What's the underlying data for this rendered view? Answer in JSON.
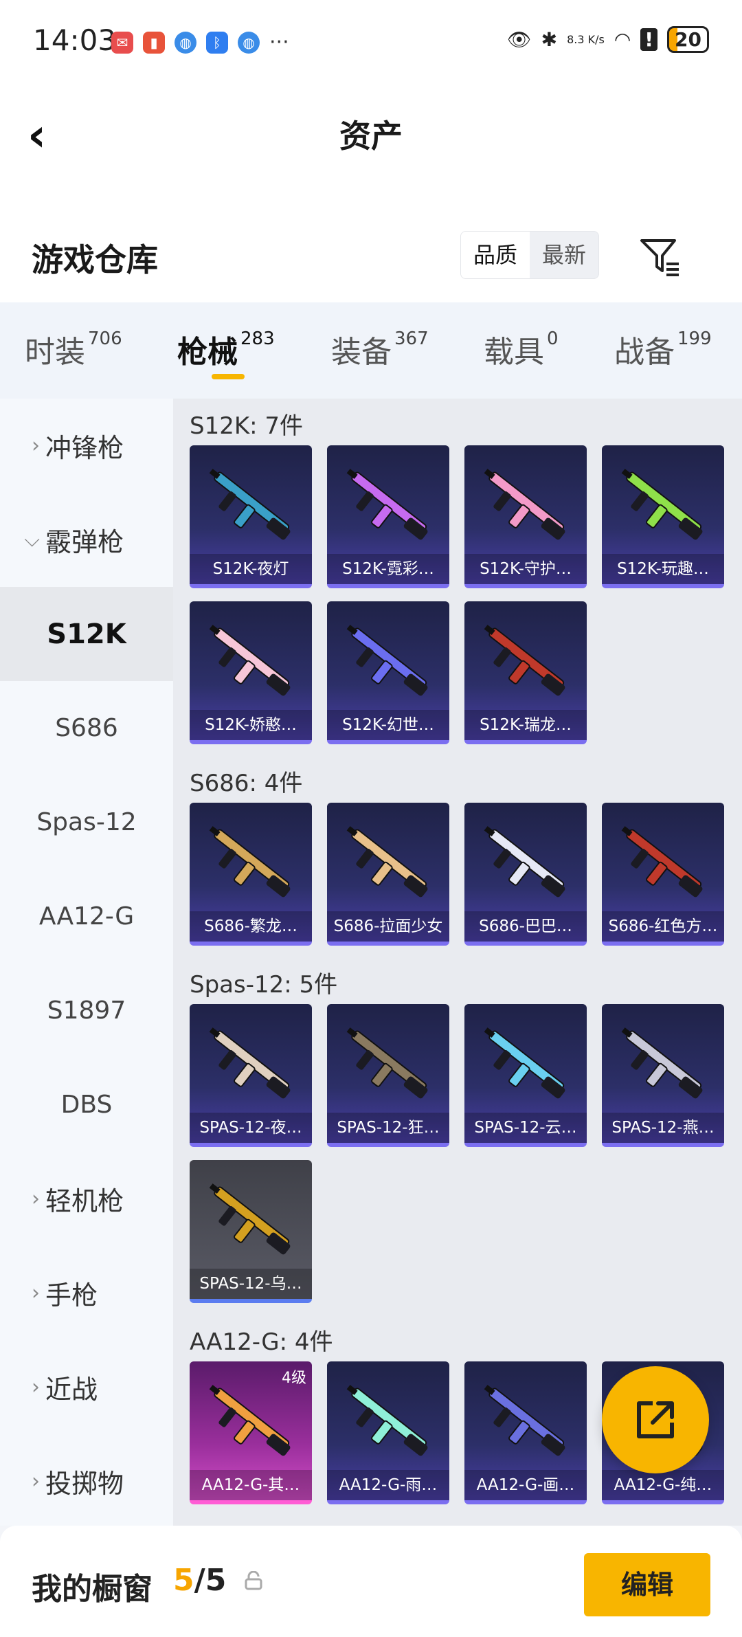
{
  "status_bar": {
    "time": "14:03",
    "net_speed": "8.3 K/s",
    "battery": "20"
  },
  "header": {
    "title": "资产"
  },
  "warehouse": {
    "title": "游戏仓库",
    "sort_options": [
      "品质",
      "最新"
    ],
    "sort_selected": "品质"
  },
  "tabs": [
    {
      "label": "时装",
      "count": "706"
    },
    {
      "label": "枪械",
      "count": "283",
      "active": true
    },
    {
      "label": "装备",
      "count": "367"
    },
    {
      "label": "载具",
      "count": "0"
    },
    {
      "label": "战备",
      "count": "199"
    }
  ],
  "sidebar": [
    {
      "label": "冲锋枪",
      "type": "category",
      "expanded": false
    },
    {
      "label": "霰弹枪",
      "type": "category",
      "expanded": true
    },
    {
      "label": "S12K",
      "type": "sub",
      "selected": true
    },
    {
      "label": "S686",
      "type": "sub"
    },
    {
      "label": "Spas-12",
      "type": "sub"
    },
    {
      "label": "AA12-G",
      "type": "sub"
    },
    {
      "label": "S1897",
      "type": "sub"
    },
    {
      "label": "DBS",
      "type": "sub"
    },
    {
      "label": "轻机枪",
      "type": "category",
      "expanded": false
    },
    {
      "label": "手枪",
      "type": "category",
      "expanded": false
    },
    {
      "label": "近战",
      "type": "category",
      "expanded": false
    },
    {
      "label": "投掷物",
      "type": "category",
      "expanded": false
    }
  ],
  "groups": [
    {
      "title": "S12K: 7件",
      "items": [
        {
          "name": "S12K-夜灯",
          "accent": "#3aa0c8"
        },
        {
          "name": "S12K-霓彩…",
          "accent": "#c66bf0"
        },
        {
          "name": "S12K-守护…",
          "accent": "#f39ac8"
        },
        {
          "name": "S12K-玩趣…",
          "accent": "#8fe04a"
        },
        {
          "name": "S12K-娇憨…",
          "accent": "#f7c6d8"
        },
        {
          "name": "S12K-幻世…",
          "accent": "#6b6ef0"
        },
        {
          "name": "S12K-瑞龙…",
          "accent": "#c0392b"
        }
      ]
    },
    {
      "title": "S686: 4件",
      "items": [
        {
          "name": "S686-繁龙…",
          "accent": "#d4a85a"
        },
        {
          "name": "S686-拉面少女",
          "accent": "#e8c08a"
        },
        {
          "name": "S686-巴巴…",
          "accent": "#e6e8f5"
        },
        {
          "name": "S686-红色方…",
          "accent": "#c0392b"
        }
      ]
    },
    {
      "title": "Spas-12: 5件",
      "items": [
        {
          "name": "SPAS-12-夜…",
          "accent": "#e0d0c0"
        },
        {
          "name": "SPAS-12-狂…",
          "accent": "#8a7a60"
        },
        {
          "name": "SPAS-12-云…",
          "accent": "#6ad0f0"
        },
        {
          "name": "SPAS-12-燕…",
          "accent": "#c8c8d8"
        },
        {
          "name": "SPAS-12-乌…",
          "accent": "#d4a020",
          "style": "gray"
        }
      ]
    },
    {
      "title": "AA12-G: 4件",
      "items": [
        {
          "name": "AA12-G-其…",
          "accent": "#f0a040",
          "style": "pink",
          "level": "4级"
        },
        {
          "name": "AA12-G-雨…",
          "accent": "#8ff0d8"
        },
        {
          "name": "AA12-G-画…",
          "accent": "#6a70e0"
        },
        {
          "name": "AA12-G-纯…",
          "accent": "#e0e0f0"
        }
      ]
    }
  ],
  "bottom_bar": {
    "title": "我的橱窗",
    "count_current": "5",
    "count_sep": "/",
    "count_total": "5",
    "edit_label": "编辑"
  }
}
